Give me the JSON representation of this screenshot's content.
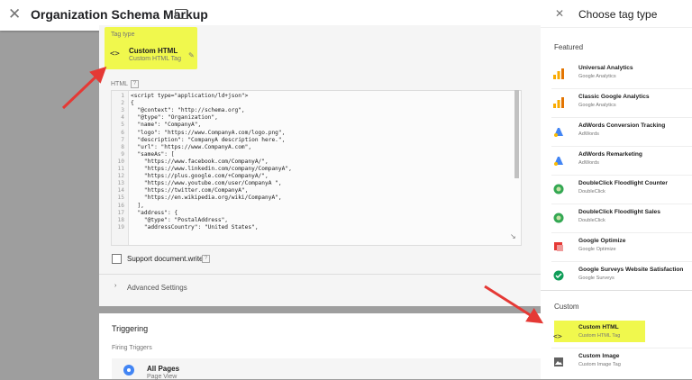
{
  "header": {
    "title": "Organization Schema Markup"
  },
  "tag_config": {
    "tag_type_label": "Tag type",
    "tag_name": "Custom HTML",
    "tag_sub": "Custom HTML Tag",
    "html_label": "HTML",
    "code_lines": [
      {
        "n": "1",
        "t": "<script type=\"application/ld+json\">"
      },
      {
        "n": "2",
        "t": "{"
      },
      {
        "n": "3",
        "t": "  \"@context\": \"http://schema.org\","
      },
      {
        "n": "4",
        "t": "  \"@type\": \"Organization\","
      },
      {
        "n": "5",
        "t": "  \"name\": \"CompanyA\","
      },
      {
        "n": "6",
        "t": "  \"logo\": \"https://www.CompanyA.com/logo.png\","
      },
      {
        "n": "7",
        "t": "  \"description\": \"CompanyA description here.\","
      },
      {
        "n": "8",
        "t": "  \"url\": \"https://www.CompanyA.com\","
      },
      {
        "n": "9",
        "t": "  \"sameAs\": ["
      },
      {
        "n": "10",
        "t": "    \"https://www.facebook.com/CompanyA/\","
      },
      {
        "n": "11",
        "t": "    \"https://www.linkedin.com/company/CompanyA\","
      },
      {
        "n": "12",
        "t": "    \"https://plus.google.com/+CompanyA/\","
      },
      {
        "n": "13",
        "t": "    \"https://www.youtube.com/user/CompanyA \","
      },
      {
        "n": "14",
        "t": "    \"https://twitter.com/CompanyA\","
      },
      {
        "n": "15",
        "t": "    \"https://en.wikipedia.org/wiki/CompanyA\","
      },
      {
        "n": "16",
        "t": "  ],"
      },
      {
        "n": "17",
        "t": "  \"address\": {"
      },
      {
        "n": "18",
        "t": "    \"@type\": \"PostalAddress\","
      },
      {
        "n": "19",
        "t": "    \"addressCountry\": \"United States\","
      }
    ],
    "support_docwrite": "Support document.write",
    "advanced": "Advanced Settings"
  },
  "triggering": {
    "title": "Triggering",
    "firing_label": "Firing Triggers",
    "trigger_name": "All Pages",
    "trigger_sub": "Page View"
  },
  "panel": {
    "title": "Choose tag type",
    "featured_label": "Featured",
    "custom_label": "Custom",
    "featured": [
      {
        "title": "Universal Analytics",
        "sub": "Google Analytics",
        "icon": "analytics-icon"
      },
      {
        "title": "Classic Google Analytics",
        "sub": "Google Analytics",
        "icon": "analytics-icon"
      },
      {
        "title": "AdWords Conversion Tracking",
        "sub": "AdWords",
        "icon": "adwords-icon"
      },
      {
        "title": "AdWords Remarketing",
        "sub": "AdWords",
        "icon": "adwords-icon"
      },
      {
        "title": "DoubleClick Floodlight Counter",
        "sub": "DoubleClick",
        "icon": "doubleclick-icon"
      },
      {
        "title": "DoubleClick Floodlight Sales",
        "sub": "DoubleClick",
        "icon": "doubleclick-icon"
      },
      {
        "title": "Google Optimize",
        "sub": "Google Optimize",
        "icon": "optimize-icon"
      },
      {
        "title": "Google Surveys Website Satisfaction",
        "sub": "Google Surveys",
        "icon": "surveys-icon"
      }
    ],
    "custom": [
      {
        "title": "Custom HTML",
        "sub": "Custom HTML Tag",
        "icon": "code-icon"
      },
      {
        "title": "Custom Image",
        "sub": "Custom Image Tag",
        "icon": "image-icon"
      }
    ]
  }
}
